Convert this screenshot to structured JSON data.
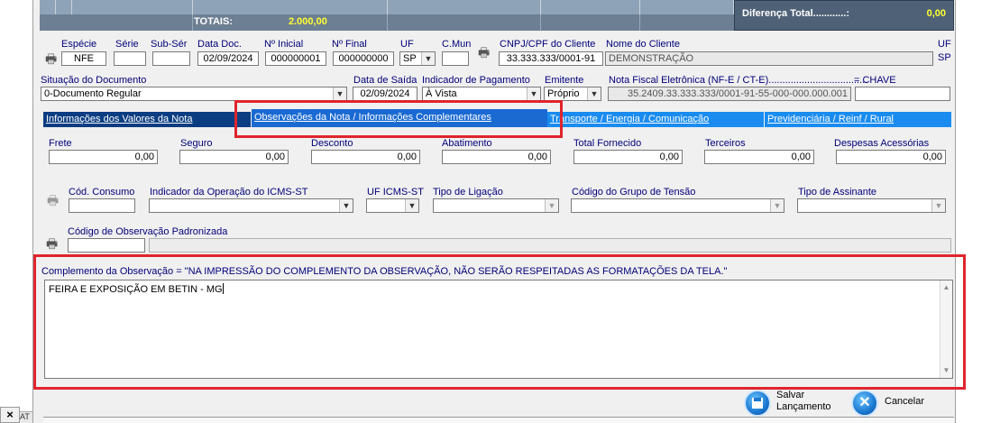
{
  "totals": {
    "label": "TOTAIS:",
    "value": "2.000,00"
  },
  "difference": {
    "label": "Diferença Total............:",
    "value": "0,00"
  },
  "doc": {
    "especie_label": "Espécie",
    "especie": "NFE",
    "serie_label": "Série",
    "serie": "",
    "subserie_label": "Sub-Sér",
    "subserie": "",
    "data_doc_label": "Data Doc.",
    "data_doc": "02/09/2024",
    "n_inicial_label": "Nº Inicial",
    "n_inicial": "000000001",
    "n_final_label": "Nº Final",
    "n_final": "000000000",
    "uf_label": "UF",
    "uf": "SP",
    "cmun_label": "C.Mun",
    "cmun": "",
    "cnpj_label": "CNPJ/CPF do Cliente",
    "cnpj": "33.333.333/0001-91",
    "cliente_label": "Nome do Cliente",
    "cliente": "DEMONSTRAÇÃO",
    "uf_right_label": "UF",
    "uf_right": "SP"
  },
  "row2": {
    "situacao_label": "Situação do Documento",
    "situacao": "0-Documento Regular",
    "data_saida_label": "Data de Saída",
    "data_saida": "02/09/2024",
    "pagamento_label": "Indicador de Pagamento",
    "pagamento": "À Vista",
    "emitente_label": "Emitente",
    "emitente": "Próprio",
    "nfe_label": "Nota Fiscal Eletrônica (NF-E / CT-E)....................................",
    "nfe": "35.2409.33.333.333/0001-91-55-000-000.000.001",
    "chave_label": "=  CHAVE",
    "chave": ""
  },
  "tabs": [
    {
      "label": "Informações dos Valores da Nota"
    },
    {
      "label": "Observações da Nota / Informações Complementares"
    },
    {
      "label": "Transporte / Energia / Comunicação"
    },
    {
      "label": "Previdenciária / Reinf / Rural"
    }
  ],
  "values": {
    "frete_label": "Frete",
    "frete": "0,00",
    "seguro_label": "Seguro",
    "seguro": "0,00",
    "desconto_label": "Desconto",
    "desconto": "0,00",
    "abatimento_label": "Abatimento",
    "abatimento": "0,00",
    "total_fornecido_label": "Total Fornecido",
    "total_fornecido": "0,00",
    "terceiros_label": "Terceiros",
    "terceiros": "0,00",
    "despesas_label": "Despesas Acessórias",
    "despesas": "0,00"
  },
  "consumo": {
    "cod_consumo_label": "Cód. Consumo",
    "indicador_icms_label": "Indicador da Operação do ICMS-ST",
    "uf_icms_label": "UF ICMS-ST",
    "tipo_ligacao_label": "Tipo de Ligação",
    "grupo_tensao_label": "Código do Grupo de Tensão",
    "tipo_assinante_label": "Tipo de Assinante"
  },
  "obs": {
    "codigo_label": "Código de Observação Padronizada",
    "complemento_label": "Complemento da Observação = \"NA IMPRESSÃO DO COMPLEMENTO DA OBSERVAÇÃO, NÃO SERÃO RESPEITADAS AS FORMATAÇÕES DA TELA.\"",
    "complemento_text": "FEIRA E EXPOSIÇÃO EM BETIN - MG"
  },
  "buttons": {
    "salvar": "Salvar Lançamento",
    "salvar_l1": "Salvar",
    "salvar_l2": "Lançamento",
    "cancelar": "Cancelar"
  },
  "bottom": {
    "close_glyph": "×",
    "status_text": "AT"
  },
  "colors": {
    "highlight": "#e0242c",
    "tab_active": "#1a6ad2",
    "tab_dark": "#0a3d82",
    "tab_light": "#1a8cf0",
    "label": "#00007a"
  }
}
